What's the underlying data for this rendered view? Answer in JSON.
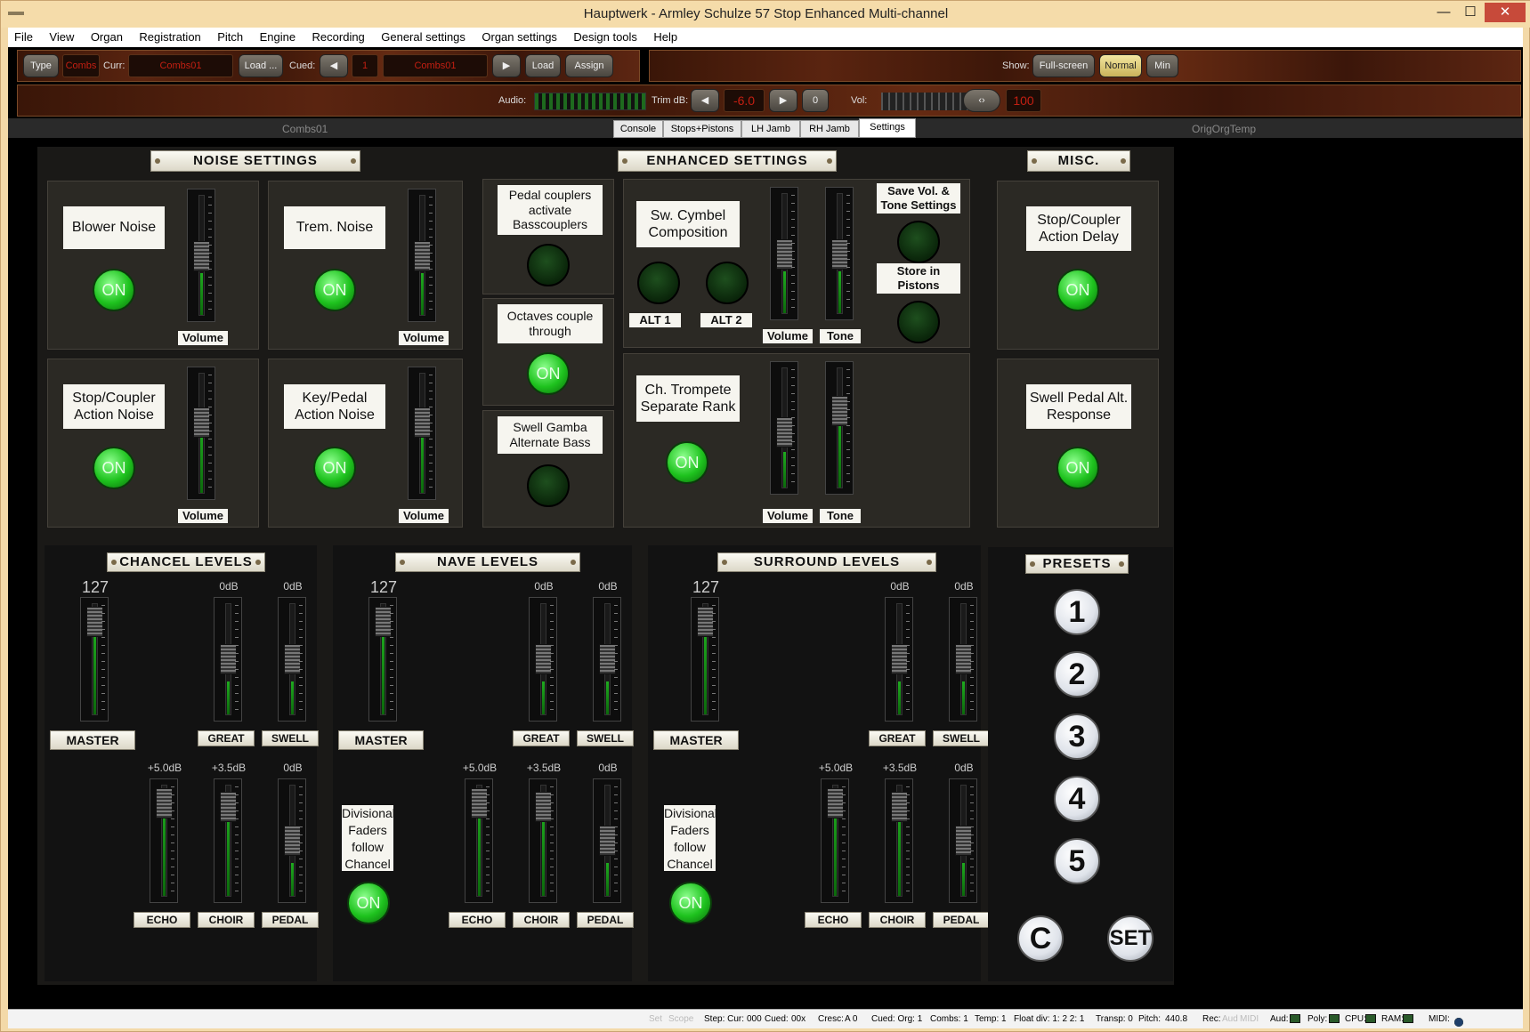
{
  "window": {
    "title": "Hauptwerk - Armley Schulze 57 Stop Enhanced Multi-channel",
    "minimize": "—",
    "maximize": "☐",
    "close": "✕"
  },
  "menu": [
    "File",
    "View",
    "Organ",
    "Registration",
    "Pitch",
    "Engine",
    "Recording",
    "General settings",
    "Organ settings",
    "Design tools",
    "Help"
  ],
  "toolbar": {
    "type_label": "Type",
    "combs_label": "Combs",
    "curr_label": "Curr:",
    "curr_value": "Combs01",
    "load_dots": "Load ...",
    "cued_label": "Cued:",
    "cued_num": "1",
    "cued_value": "Combs01",
    "load": "Load",
    "assign": "Assign",
    "show_label": "Show:",
    "fullscreen": "Full-screen",
    "normal": "Normal",
    "min": "Min",
    "audio_label": "Audio:",
    "trim_label": "Trim dB:",
    "trim_value": "-6.0",
    "zero": "0",
    "vol_label": "Vol:",
    "vol_value": "100"
  },
  "tabs": [
    "Console",
    "Stops+Pistons",
    "LH Jamb",
    "RH Jamb",
    "Settings"
  ],
  "active_tab": "Settings",
  "left_label": "Combs01",
  "right_label": "OrigOrgTemp",
  "noise": {
    "title": "NOISE SETTINGS",
    "items": [
      {
        "label": "Blower Noise",
        "state": "ON",
        "slider_label": "Volume",
        "level": 0.35
      },
      {
        "label": "Trem. Noise",
        "state": "ON",
        "slider_label": "Volume",
        "level": 0.35
      },
      {
        "label": "Stop/Coupler Action Noise",
        "state": "ON",
        "slider_label": "Volume",
        "level": 0.55
      },
      {
        "label": "Key/Pedal Action Noise",
        "state": "ON",
        "slider_label": "Volume",
        "level": 0.55
      }
    ]
  },
  "enhanced": {
    "title": "ENHANCED SETTINGS",
    "pedal_couplers": "Pedal couplers activate Basscouplers",
    "octaves": "Octaves couple through",
    "octaves_state": "ON",
    "swell_gamba": "Swell Gamba Alternate Bass",
    "cymbel": "Sw. Cymbel Composition",
    "alt1": "ALT 1",
    "alt2": "ALT 2",
    "save_vol": "Save Vol. & Tone Settings",
    "store": "Store in Pistons",
    "trompete": "Ch. Trompete Separate Rank",
    "trompete_state": "ON",
    "volume": "Volume",
    "tone": "Tone"
  },
  "misc": {
    "title": "MISC.",
    "action_delay": "Stop/Coupler Action Delay",
    "action_delay_state": "ON",
    "swell_pedal": "Swell Pedal Alt. Response",
    "swell_pedal_state": "ON"
  },
  "levels": [
    {
      "title": "CHANCEL LEVELS",
      "master_val": "127",
      "great_db": "0dB",
      "swell_db": "0dB",
      "echo_db": "+5.0dB",
      "choir_db": "+3.5dB",
      "pedal_db": "0dB",
      "master": "MASTER",
      "great": "GREAT",
      "swell": "SWELL",
      "echo": "ECHO",
      "choir": "CHOIR",
      "pedal": "PEDAL"
    },
    {
      "title": "NAVE LEVELS",
      "master_val": "127",
      "great_db": "0dB",
      "swell_db": "0dB",
      "echo_db": "+5.0dB",
      "choir_db": "+3.5dB",
      "pedal_db": "0dB",
      "master": "MASTER",
      "great": "GREAT",
      "swell": "SWELL",
      "echo": "ECHO",
      "choir": "CHOIR",
      "pedal": "PEDAL",
      "divisional": "Divisional Faders follow Chancel",
      "div_state": "ON"
    },
    {
      "title": "SURROUND LEVELS",
      "master_val": "127",
      "great_db": "0dB",
      "swell_db": "0dB",
      "echo_db": "+5.0dB",
      "choir_db": "+3.5dB",
      "pedal_db": "0dB",
      "master": "MASTER",
      "great": "GREAT",
      "swell": "SWELL",
      "echo": "ECHO",
      "choir": "CHOIR",
      "pedal": "PEDAL",
      "divisional": "Divisional Faders follow Chancel",
      "div_state": "ON"
    }
  ],
  "presets": {
    "title": "PRESETS",
    "buttons": [
      "1",
      "2",
      "3",
      "4",
      "5"
    ],
    "cancel": "C",
    "set": "SET"
  },
  "status": {
    "set": "Set",
    "scope": "Scope",
    "step": "Step: Cur:",
    "step_cur": "000",
    "cued": "Cued:",
    "cued_val": "00x",
    "cresc": "Cresc:",
    "cresc_val": "A 0",
    "cued_org": "Cued: Org: 1",
    "combs": "Combs: 1",
    "temp": "Temp: 1",
    "float": "Float div: 1: 2 2: 1",
    "transp": "Transp: 0",
    "pitch": "Pitch:",
    "pitch_val": "440.8",
    "rec": "Rec:",
    "aud": "Aud",
    "midi": "MIDI",
    "aud2": "Aud:",
    "poly": "Poly:",
    "cpu": "CPU:",
    "ram": "RAM:",
    "midi2": "MIDI:"
  },
  "colors": {
    "accent_red": "#c31f12",
    "on_green": "#1ec21e",
    "plaque": "#f6f5ef"
  }
}
